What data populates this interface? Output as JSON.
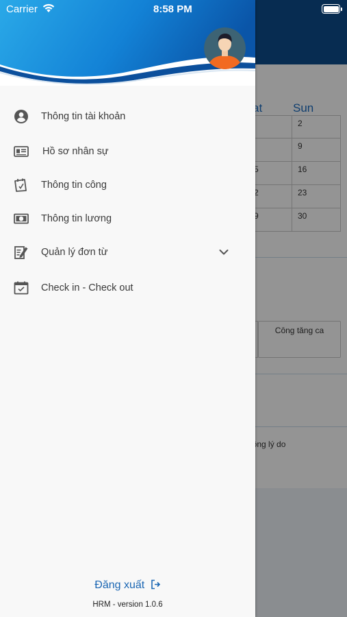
{
  "status_bar": {
    "carrier": "Carrier",
    "time": "8:58 PM"
  },
  "background": {
    "calendar": {
      "day_headers": [
        "at",
        "Sun"
      ],
      "rows": [
        [
          "",
          "2"
        ],
        [
          "",
          "9"
        ],
        [
          "5",
          "16"
        ],
        [
          "2",
          "23"
        ],
        [
          "9",
          "30"
        ]
      ]
    },
    "card_label": "Công tăng ca",
    "note_text": "hông lý do"
  },
  "drawer": {
    "menu": [
      {
        "label": "Thông tin tài khoản",
        "icon": "account-circle-icon"
      },
      {
        "label": "Hồ sơ nhân sự",
        "icon": "id-card-icon"
      },
      {
        "label": "Thông tin công",
        "icon": "timesheet-icon"
      },
      {
        "label": "Thông tin lương",
        "icon": "money-icon"
      },
      {
        "label": "Quản lý đơn từ",
        "icon": "edit-document-icon",
        "expandable": true
      },
      {
        "label": "Check in - Check out",
        "icon": "calendar-check-icon"
      }
    ],
    "logout_label": "Đăng xuất",
    "version": "HRM - version 1.0.6"
  },
  "colors": {
    "header_blue": "#0d4d8c",
    "accent_blue": "#1a66b3",
    "drawer_bg": "#f8f8f8",
    "avatar_bg": "#3d6374",
    "avatar_shirt": "#f26a21"
  }
}
